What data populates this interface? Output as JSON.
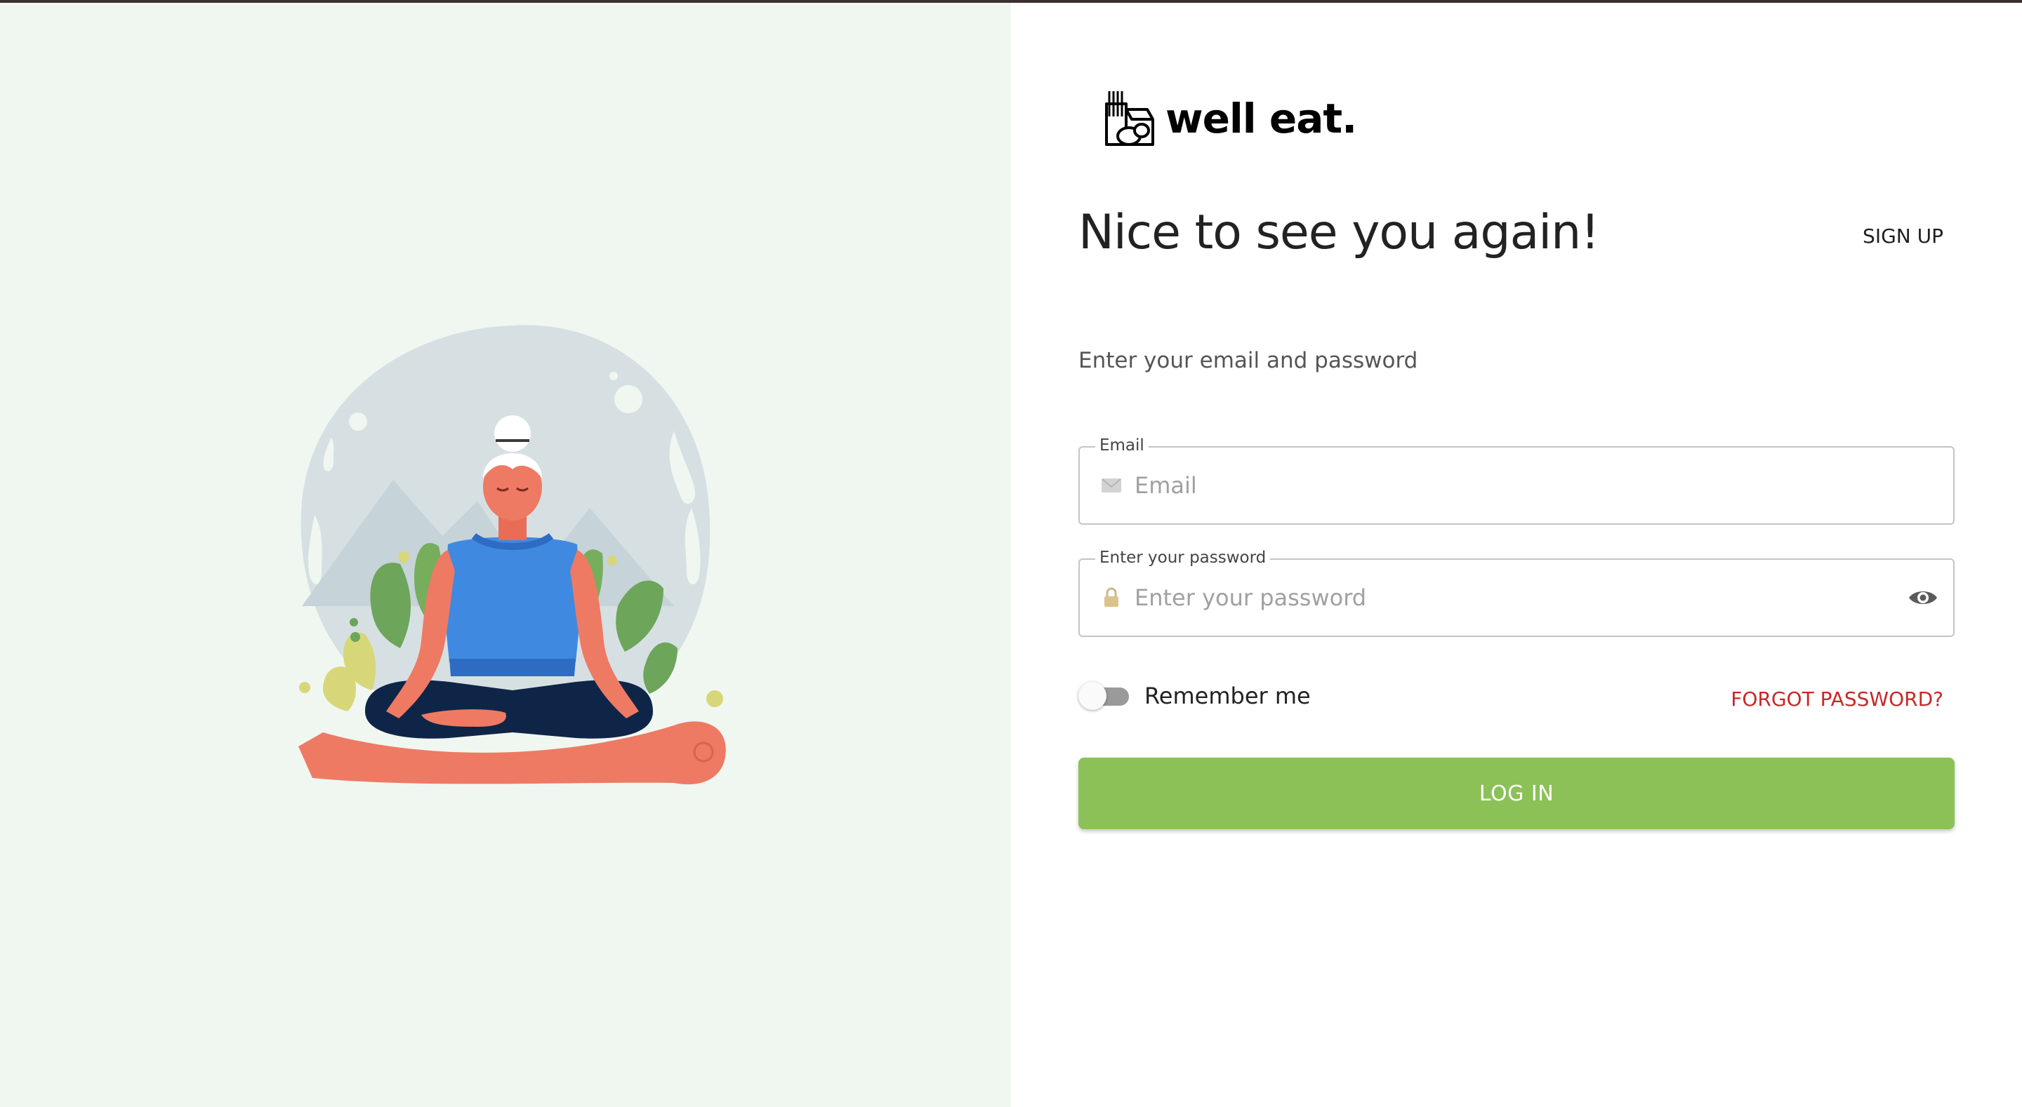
{
  "brand": {
    "name": "well eat.",
    "logo_icon": "grocery-bag-icon"
  },
  "header": {
    "title": "Nice to see you again!",
    "signup_label": "SIGN UP"
  },
  "form": {
    "instructions": "Enter your email and password",
    "email": {
      "label": "Email",
      "placeholder": "Email",
      "value": "",
      "icon": "mail-icon"
    },
    "password": {
      "label": "Enter your password",
      "placeholder": "Enter your password",
      "value": "",
      "icon": "lock-icon",
      "toggle_icon": "eye-icon"
    },
    "remember_me": {
      "label": "Remember me",
      "checked": false
    },
    "forgot_label": "FORGOT PASSWORD?",
    "submit_label": "LOG IN"
  },
  "illustration": {
    "subject": "meditation-illustration"
  },
  "colors": {
    "left_background": "#f0f7f1",
    "primary_button": "#8bc157",
    "forgot_link": "#c62828",
    "switch_track": "#9a9a9a"
  }
}
